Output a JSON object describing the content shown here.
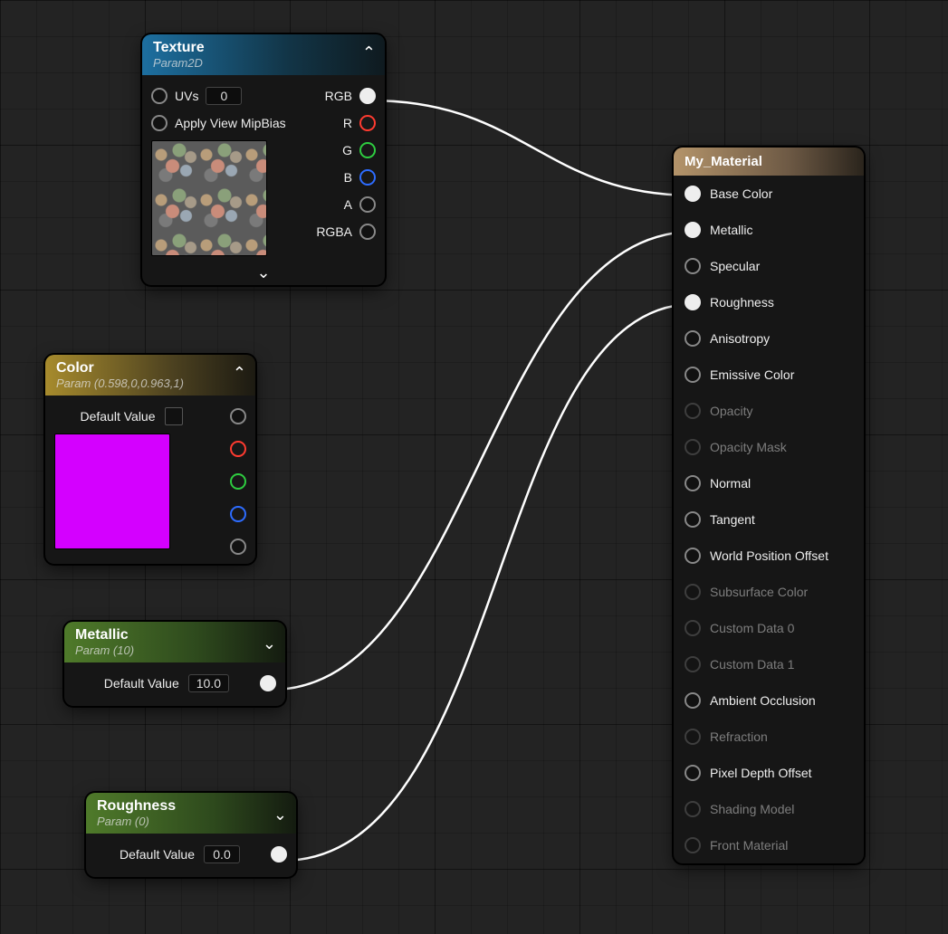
{
  "nodes": {
    "texture": {
      "title": "Texture",
      "subtitle": "Param2D",
      "inputs": {
        "uvs": "UVs",
        "uvs_value": "0",
        "mipbias": "Apply View MipBias"
      },
      "outputs": {
        "rgb": "RGB",
        "r": "R",
        "g": "G",
        "b": "B",
        "a": "A",
        "rgba": "RGBA"
      }
    },
    "color": {
      "title": "Color",
      "subtitle": "Param (0.598,0,0.963,1)",
      "default_label": "Default Value",
      "swatch_color": "#d400ff"
    },
    "metallic": {
      "title": "Metallic",
      "subtitle": "Param (10)",
      "default_label": "Default Value",
      "default_value": "10.0"
    },
    "roughness": {
      "title": "Roughness",
      "subtitle": "Param (0)",
      "default_label": "Default Value",
      "default_value": "0.0"
    },
    "material": {
      "title": "My_Material",
      "pins": [
        {
          "label": "Base Color",
          "active": true,
          "connected": true
        },
        {
          "label": "Metallic",
          "active": true,
          "connected": true
        },
        {
          "label": "Specular",
          "active": true,
          "connected": false
        },
        {
          "label": "Roughness",
          "active": true,
          "connected": true
        },
        {
          "label": "Anisotropy",
          "active": true,
          "connected": false
        },
        {
          "label": "Emissive Color",
          "active": true,
          "connected": false
        },
        {
          "label": "Opacity",
          "active": false,
          "connected": false
        },
        {
          "label": "Opacity Mask",
          "active": false,
          "connected": false
        },
        {
          "label": "Normal",
          "active": true,
          "connected": false
        },
        {
          "label": "Tangent",
          "active": true,
          "connected": false
        },
        {
          "label": "World Position Offset",
          "active": true,
          "connected": false
        },
        {
          "label": "Subsurface Color",
          "active": false,
          "connected": false
        },
        {
          "label": "Custom Data 0",
          "active": false,
          "connected": false
        },
        {
          "label": "Custom Data 1",
          "active": false,
          "connected": false
        },
        {
          "label": "Ambient Occlusion",
          "active": true,
          "connected": false
        },
        {
          "label": "Refraction",
          "active": false,
          "connected": false
        },
        {
          "label": "Pixel Depth Offset",
          "active": true,
          "connected": false
        },
        {
          "label": "Shading Model",
          "active": false,
          "connected": false
        },
        {
          "label": "Front Material",
          "active": false,
          "connected": false
        }
      ]
    }
  },
  "connections": [
    {
      "from": "texture.rgb",
      "to": "material.Base Color"
    },
    {
      "from": "metallic.out",
      "to": "material.Metallic"
    },
    {
      "from": "roughness.out",
      "to": "material.Roughness"
    }
  ]
}
